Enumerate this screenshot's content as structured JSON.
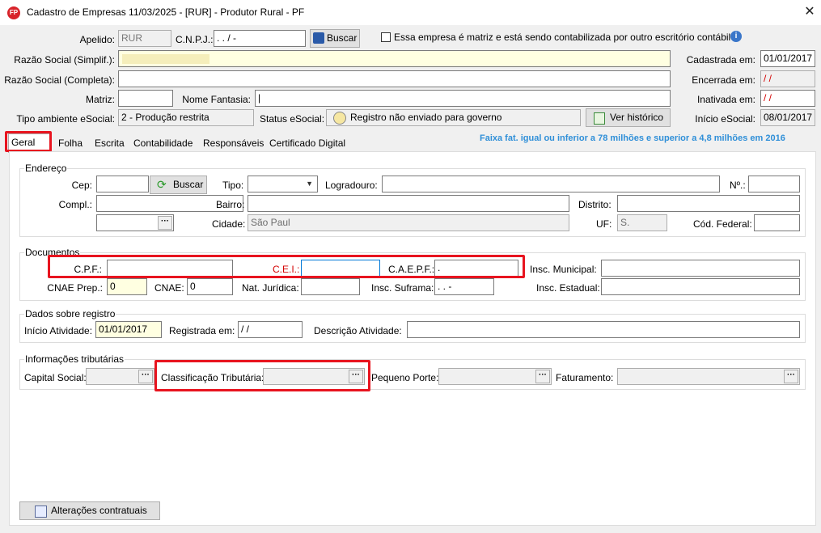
{
  "window": {
    "title": "Cadastro de Empresas  11/03/2025 - [RUR] - Produtor Rural - PF",
    "icon_text": "FP"
  },
  "header": {
    "apelido_label": "Apelido:",
    "apelido_value": "RUR",
    "cnpj_label": "C.N.P.J.:",
    "cnpj_value": " .   .   /    -",
    "buscar_label": "Buscar",
    "matriz_check_label": "Essa empresa é matriz e está sendo contabilizada por outro escritório contábil",
    "razao_simpl_label": "Razão Social (Simplif.):",
    "razao_compl_label": "Razão Social (Completa):",
    "matriz_label": "Matriz:",
    "nome_fantasia_label": "Nome Fantasia:",
    "nome_fantasia_value": "|",
    "tipo_ambiente_label": "Tipo ambiente eSocial:",
    "tipo_ambiente_value": "2 - Produção restrita",
    "status_esocial_label": "Status eSocial:",
    "status_esocial_value": "Registro não enviado para governo",
    "ver_historico_label": "Ver histórico",
    "cadastrada_label": "Cadastrada em:",
    "cadastrada_value": "01/01/2017",
    "encerrada_label": "Encerrada em:",
    "encerrada_value": " / /",
    "inativada_label": "Inativada em:",
    "inativada_value": " / /",
    "inicio_esocial_label": "Início eSocial:",
    "inicio_esocial_value": "08/01/2017"
  },
  "tabs": [
    {
      "label": "Geral"
    },
    {
      "label": "Folha"
    },
    {
      "label": "Escrita"
    },
    {
      "label": "Contabilidade"
    },
    {
      "label": "Responsáveis"
    },
    {
      "label": "Certificado Digital"
    }
  ],
  "faixa_text": "Faixa fat. igual ou inferior a 78 milhões e superior a 4,8 milhões em 2016",
  "endereco": {
    "title": "Endereço",
    "cep_label": "Cep:",
    "buscar_label": "Buscar",
    "tipo_label": "Tipo:",
    "logradouro_label": "Logradouro:",
    "numero_label": "Nº.:",
    "compl_label": "Compl.:",
    "bairro_label": "Bairro:",
    "distrito_label": "Distrito:",
    "cidade_label": "Cidade:",
    "cidade_value": "São Paul",
    "uf_label": "UF:",
    "uf_value": "S.",
    "cod_federal_label": "Cód. Federal:"
  },
  "documentos": {
    "title": "Documentos",
    "cpf_label": "C.P.F.:",
    "cei_label": "C.E.I.:",
    "caepf_label": "C.A.E.P.F.:",
    "caepf_value": "                  .",
    "insc_municipal_label": "Insc. Municipal:",
    "cnae_prep_label": "CNAE Prep.:",
    "cnae_prep_value": "0",
    "cnae_label": "CNAE:",
    "cnae_value": "0",
    "nat_juridica_label": "Nat. Jurídica:",
    "insc_suframa_label": "Insc. Suframa:",
    "insc_suframa_value": "  .   .   -",
    "insc_estadual_label": "Insc. Estadual:"
  },
  "registro": {
    "title": "Dados sobre registro",
    "inicio_atividade_label": "Início Atividade:",
    "inicio_atividade_value": "01/01/2017",
    "registrada_label": "Registrada em:",
    "registrada_value": " /  /",
    "descricao_label": "Descrição Atividade:"
  },
  "tributarias": {
    "title": "Informações tributárias",
    "capital_label": "Capital Social:",
    "classificacao_label": "Classificação Tributária:",
    "pequeno_porte_label": "Pequeno Porte:",
    "faturamento_label": "Faturamento:"
  },
  "footer": {
    "alteracoes_label": "Alterações contratuais"
  },
  "colors": {
    "highlight": "#e8141f",
    "faixa": "#2f8fd8",
    "required": "#d40000"
  },
  "icons": [
    "fp-app-icon",
    "close-icon",
    "receita-icon",
    "info-icon",
    "esocial-status-icon",
    "historico-icon",
    "refresh-icon",
    "ellipsis-icon",
    "document-icon",
    "chevron-down-icon"
  ]
}
